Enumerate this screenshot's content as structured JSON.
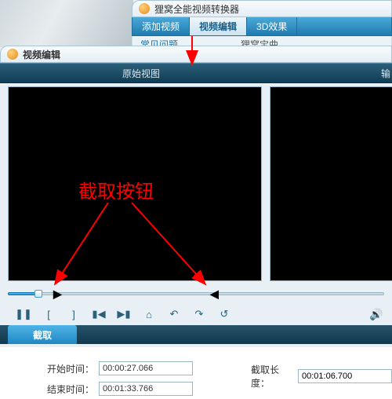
{
  "app": {
    "title": "狸窝全能视频转换器"
  },
  "main_tabs": {
    "items": [
      {
        "label": "添加视频"
      },
      {
        "label": "视频编辑"
      },
      {
        "label": "3D效果"
      }
    ],
    "active_index": 1
  },
  "faq_bar": {
    "link1": "常见问题",
    "link2": "狸窝宝曲"
  },
  "editor": {
    "title": "视频编辑"
  },
  "view_header": {
    "left": "原始视图",
    "right": "输"
  },
  "annotation": {
    "text": "截取按钮"
  },
  "timeline": {
    "pos_percent": 8
  },
  "toolbar_icons": {
    "pause": "❚❚",
    "mark_in": "[",
    "mark_out": "]",
    "prev": "▮◀",
    "next": "▶▮",
    "zoom_center": "⌂",
    "rotate_left": "↶",
    "rotate_right": "↷",
    "undo": "↺",
    "speaker": "🔊"
  },
  "section": {
    "tab_label": "截取"
  },
  "form": {
    "start_label": "开始时间：",
    "start_value": "00:00:27.066",
    "end_label": "结束时间：",
    "end_value": "00:01:33.766",
    "dur_label": "截取长度：",
    "dur_value": "00:01:06.700"
  }
}
